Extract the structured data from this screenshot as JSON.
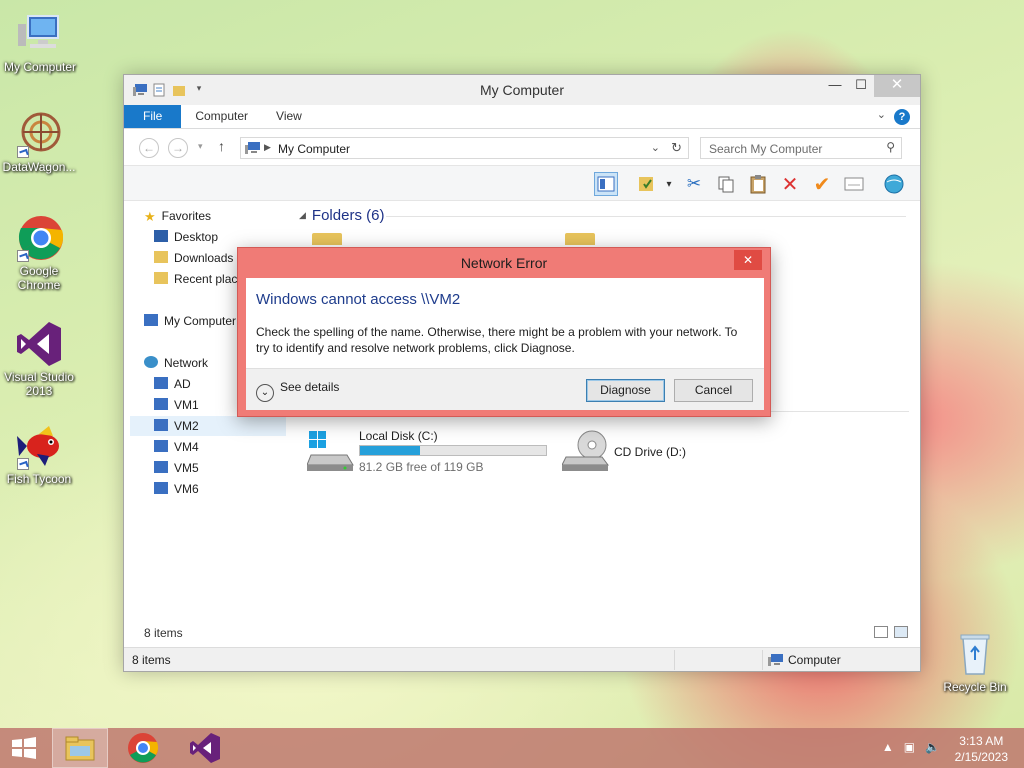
{
  "desktop": {
    "icons": [
      {
        "label": "My Computer"
      },
      {
        "label": "DataWagon..."
      },
      {
        "label": "Google Chrome"
      },
      {
        "label": "Visual Studio 2013"
      },
      {
        "label": "Fish Tycoon"
      },
      {
        "label": "Recycle Bin"
      }
    ]
  },
  "window": {
    "title": "My Computer",
    "controls": {
      "minimize": "—",
      "maximize": "☐",
      "close": "✕"
    },
    "ribbon": {
      "tabs": [
        {
          "label": "File"
        },
        {
          "label": "Computer"
        },
        {
          "label": "View"
        }
      ],
      "help": "?"
    },
    "address": {
      "path": "My Computer",
      "search_placeholder": "Search My Computer"
    },
    "nav": {
      "favorites": "Favorites",
      "desktop": "Desktop",
      "downloads": "Downloads",
      "recent": "Recent places",
      "computer": "My Computer",
      "network": "Network",
      "hosts": [
        {
          "label": "AD"
        },
        {
          "label": "VM1"
        },
        {
          "label": "VM2"
        },
        {
          "label": "VM4"
        },
        {
          "label": "VM5"
        },
        {
          "label": "VM6"
        }
      ]
    },
    "folders_header": "Folders (6)",
    "drives": [
      {
        "name": "Local Disk (C:)",
        "free": "81.2 GB free of 119 GB",
        "used_fraction": 0.32
      },
      {
        "name": "CD Drive (D:)"
      }
    ],
    "item_count": "8 items",
    "status": {
      "left": "8 items",
      "right": "Computer"
    }
  },
  "dialog": {
    "title": "Network Error",
    "close": "✕",
    "heading": "Windows cannot access \\\\VM2",
    "message": "Check the spelling of the name. Otherwise, there might be a problem with your network. To try to identify and resolve network problems, click Diagnose.",
    "details": "See details",
    "diagnose": "Diagnose",
    "cancel": "Cancel"
  },
  "taskbar": {
    "time": "3:13 AM",
    "date": "2/15/2023"
  },
  "colors": {
    "accent": "#1979ca",
    "dialog_frame": "#f07b76",
    "drive_fill": "#26a0da"
  }
}
